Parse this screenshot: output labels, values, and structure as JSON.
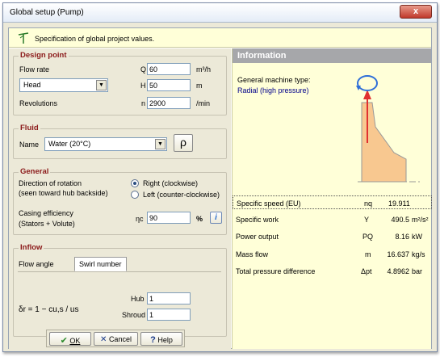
{
  "window": {
    "title": "Global setup (Pump)",
    "close_label": "x"
  },
  "header": {
    "text": "Specification of global project values."
  },
  "design_point": {
    "legend": "Design point",
    "flow_rate_label": "Flow rate",
    "q_symbol": "Q",
    "q_value": "60",
    "q_unit": "m³/h",
    "head_select": "Head",
    "h_symbol": "H",
    "h_value": "50",
    "h_unit": "m",
    "revolutions_label": "Revolutions",
    "n_symbol": "n",
    "n_value": "2900",
    "n_unit": "/min"
  },
  "fluid": {
    "legend": "Fluid",
    "name_label": "Name",
    "name_value": "Water (20°C)",
    "rho_button": "ρ"
  },
  "general": {
    "legend": "General",
    "direction_label_1": "Direction of rotation",
    "direction_label_2": "(seen toward hub backside)",
    "right_label": "Right (clockwise)",
    "left_label": "Left (counter-clockwise)",
    "casing_label_1": "Casing efficiency",
    "casing_label_2": "(Stators + Volute)",
    "eta_symbol": "ηc",
    "eta_value": "90",
    "eta_unit": "%",
    "info_icon": "i"
  },
  "inflow": {
    "legend": "Inflow",
    "tab_flow_angle": "Flow angle",
    "tab_swirl": "Swirl number",
    "formula": "δr = 1 − cu,s / us",
    "hub_label": "Hub",
    "hub_value": "1",
    "shroud_label": "Shroud",
    "shroud_value": "1"
  },
  "buttons": {
    "ok": "OK",
    "cancel": "Cancel",
    "help": "Help"
  },
  "information": {
    "title": "Information",
    "machine_type_label": "General machine type:",
    "machine_type_value": "Radial (high pressure)",
    "results": [
      {
        "label": "Specific speed (EU)",
        "symbol": "nq",
        "value": "19.911",
        "unit": ""
      },
      {
        "label": "Specific work",
        "symbol": "Y",
        "value": "490.5",
        "unit": "m²/s²"
      },
      {
        "label": "Power output",
        "symbol": "PQ",
        "value": "8.16",
        "unit": "kW"
      },
      {
        "label": "Mass flow",
        "symbol": "m",
        "value": "16.637",
        "unit": "kg/s"
      },
      {
        "label": "Total pressure difference",
        "symbol": "Δpt",
        "value": "4.8962",
        "unit": "bar"
      }
    ]
  },
  "colors": {
    "accent_red": "#8b1a1a",
    "info_bg": "#ffffd8",
    "impeller_fill": "#f8c890",
    "arrow": "#e03030",
    "rotation_ring": "#2f6fd8"
  }
}
